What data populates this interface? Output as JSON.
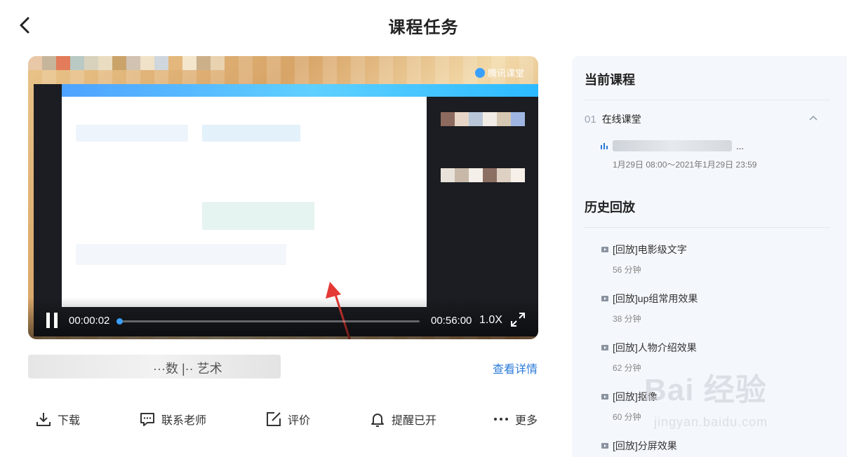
{
  "header": {
    "title": "课程任务"
  },
  "player": {
    "brand": "腾讯课堂",
    "current_time": "00:00:02",
    "total_time": "00:56:00",
    "speed": "1.0X",
    "progress_fraction": 0.0006
  },
  "course": {
    "title_fragment": "···数 |·· 艺术",
    "details_label": "查看详情"
  },
  "actions": {
    "download": "下载",
    "contact": "联系老师",
    "review": "评价",
    "reminder": "提醒已开",
    "more": "更多"
  },
  "side": {
    "current_title": "当前课程",
    "chapter_num": "01",
    "chapter_name": "在线课堂",
    "live_title_suffix": "...",
    "live_time": "1月29日 08:00～2021年1月29日 23:59",
    "history_title": "历史回放",
    "replays": [
      {
        "title": "[回放]电影级文字",
        "duration": "56 分钟"
      },
      {
        "title": "[回放]up组常用效果",
        "duration": "38 分钟"
      },
      {
        "title": "[回放]人物介绍效果",
        "duration": "62 分钟"
      },
      {
        "title": "[回放]抠像",
        "duration": "60 分钟"
      },
      {
        "title": "[回放]分屏效果",
        "duration": ""
      }
    ]
  },
  "watermark": {
    "main": "Bai 经验",
    "sub": "jingyan.baidu.com"
  }
}
